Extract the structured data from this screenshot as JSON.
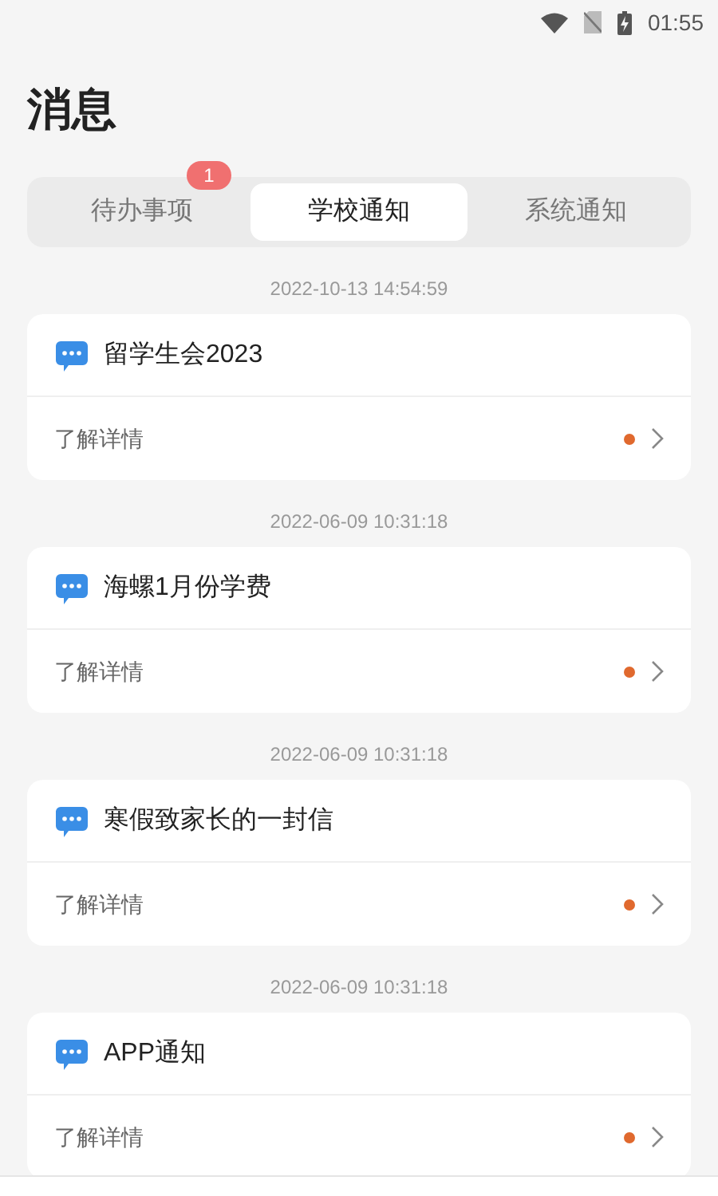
{
  "status_bar": {
    "time": "01:55"
  },
  "title": "消息",
  "tabs": [
    {
      "label": "待办事项",
      "selected": false,
      "badge": "1"
    },
    {
      "label": "学校通知",
      "selected": true
    },
    {
      "label": "系统通知",
      "selected": false
    }
  ],
  "messages": [
    {
      "time": "2022-10-13 14:54:59",
      "title": "留学生会2023",
      "action": "了解详情",
      "unread": true
    },
    {
      "time": "2022-06-09 10:31:18",
      "title": "海螺1月份学费",
      "action": "了解详情",
      "unread": true
    },
    {
      "time": "2022-06-09 10:31:18",
      "title": "寒假致家长的一封信",
      "action": "了解详情",
      "unread": true
    },
    {
      "time": "2022-06-09 10:31:18",
      "title": "APP通知",
      "action": "了解详情",
      "unread": true
    }
  ]
}
